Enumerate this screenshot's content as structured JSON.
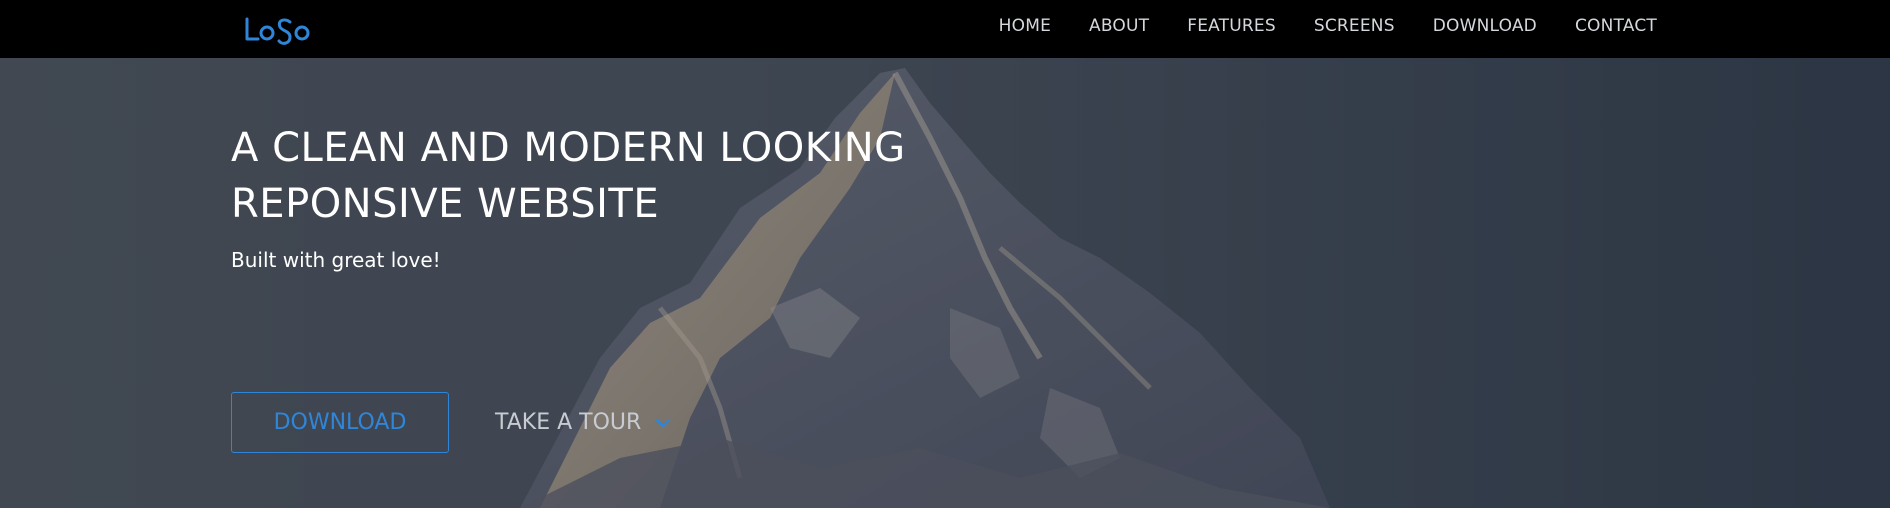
{
  "brand": {
    "logo_text": "LoSo",
    "accent_color": "#2f86d8"
  },
  "nav": {
    "items": [
      {
        "label": "HOME"
      },
      {
        "label": "ABOUT"
      },
      {
        "label": "FEATURES"
      },
      {
        "label": "SCREENS"
      },
      {
        "label": "DOWNLOAD"
      },
      {
        "label": "CONTACT"
      }
    ]
  },
  "hero": {
    "title_line1": "A CLEAN AND MODERN LOOKING",
    "title_line2": "REPONSIVE WEBSITE",
    "subtitle": "Built with great love!",
    "download_label": "DOWNLOAD",
    "tour_label": "TAKE A TOUR",
    "tour_icon": "chevron-down-icon",
    "background_image": "snowy mountain peak"
  }
}
